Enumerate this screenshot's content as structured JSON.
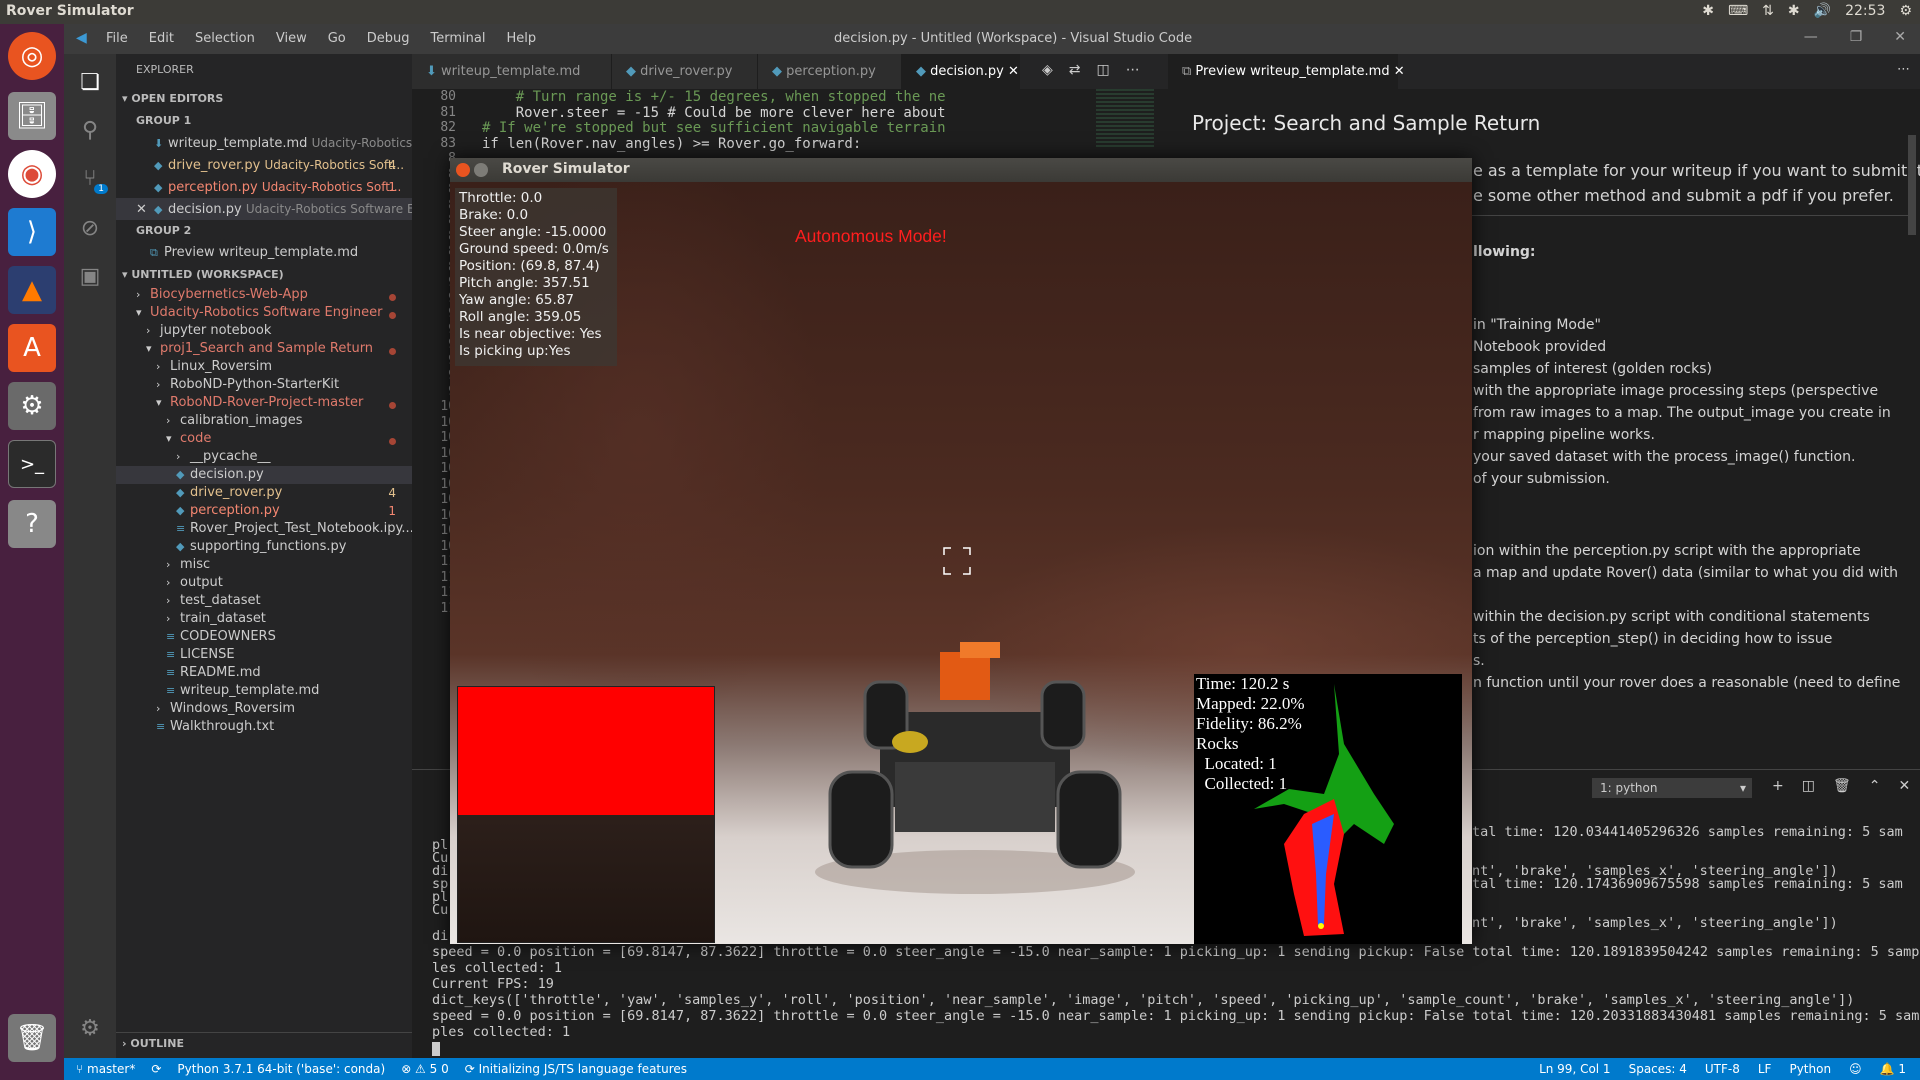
{
  "topbar": {
    "app_title": "Rover Simulator",
    "clock": "22:53"
  },
  "vscode": {
    "window_title": "decision.py - Untitled (Workspace) - Visual Studio Code",
    "menu": [
      "File",
      "Edit",
      "Selection",
      "View",
      "Go",
      "Debug",
      "Terminal",
      "Help"
    ],
    "scm_badge": "1"
  },
  "explorer": {
    "title": "EXPLORER",
    "open_editors": "OPEN EDITORS",
    "group1": "GROUP 1",
    "group2": "GROUP 2",
    "workspace": "UNTITLED (WORKSPACE)",
    "outline": "OUTLINE",
    "open_files": [
      {
        "name": "writeup_template.md",
        "path": "Udacity-Robotics ...",
        "badge": ""
      },
      {
        "name": "drive_rover.py",
        "path": "Udacity-Robotics Soft...",
        "badge": "4"
      },
      {
        "name": "perception.py",
        "path": "Udacity-Robotics Soft...",
        "badge": "1"
      },
      {
        "name": "decision.py",
        "path": "Udacity-Robotics Software E...",
        "badge": ""
      }
    ],
    "group2_file": "Preview writeup_template.md",
    "tree": [
      {
        "label": "Biocybernetics-Web-App",
        "indent": 0
      },
      {
        "label": "Udacity-Robotics Software Engineer",
        "indent": 0
      },
      {
        "label": "jupyter notebook",
        "indent": 1
      },
      {
        "label": "proj1_Search and Sample Return",
        "indent": 1
      },
      {
        "label": "Linux_Roversim",
        "indent": 2
      },
      {
        "label": "RoboND-Python-StarterKit",
        "indent": 2
      },
      {
        "label": "RoboND-Rover-Project-master",
        "indent": 2
      },
      {
        "label": "calibration_images",
        "indent": 3
      },
      {
        "label": "code",
        "indent": 3
      },
      {
        "label": "__pycache__",
        "indent": 4
      },
      {
        "label": "decision.py",
        "indent": 4
      },
      {
        "label": "drive_rover.py",
        "indent": 4,
        "badge": "4"
      },
      {
        "label": "perception.py",
        "indent": 4,
        "badge": "1"
      },
      {
        "label": "Rover_Project_Test_Notebook.ipy...",
        "indent": 4
      },
      {
        "label": "supporting_functions.py",
        "indent": 4
      },
      {
        "label": "misc",
        "indent": 3
      },
      {
        "label": "output",
        "indent": 3
      },
      {
        "label": "test_dataset",
        "indent": 3
      },
      {
        "label": "train_dataset",
        "indent": 3
      },
      {
        "label": "CODEOWNERS",
        "indent": 3
      },
      {
        "label": "LICENSE",
        "indent": 3
      },
      {
        "label": "README.md",
        "indent": 3
      },
      {
        "label": "writeup_template.md",
        "indent": 3
      },
      {
        "label": "Windows_Roversim",
        "indent": 2
      },
      {
        "label": "Walkthrough.txt",
        "indent": 2
      }
    ]
  },
  "tabs": [
    "writeup_template.md",
    "drive_rover.py",
    "perception.py",
    "decision.py"
  ],
  "preview_tab": "Preview writeup_template.md",
  "editor": {
    "lines": [
      {
        "n": "80",
        "code": "    # Turn range is +/- 15 degrees, when stopped the ne"
      },
      {
        "n": "81",
        "code": "    Rover.steer = -15 # Could be more clever here about"
      },
      {
        "n": "82",
        "code": "# If we're stopped but see sufficient navigable terrain"
      },
      {
        "n": "83",
        "code": "if len(Rover.nav_angles) >= Rover.go_forward:"
      }
    ],
    "gutter_more": [
      "8",
      "8",
      "8",
      "8",
      "8",
      "8",
      "8",
      "8",
      "9",
      "9",
      "9",
      "9",
      "9",
      "9",
      "9",
      "9",
      "10",
      "10",
      "10",
      "10",
      "10",
      "10",
      "10",
      "10",
      "10",
      "10",
      "11",
      "11",
      "11",
      "11"
    ]
  },
  "preview": {
    "heading": "Project: Search and Sample Return",
    "lines": [
      "e as a template for your writeup if you want to submit it",
      "e some other method and submit a pdf if you prefer.",
      "llowing:",
      "in \"Training Mode\"",
      "Notebook provided",
      "samples of interest (golden rocks)",
      "with the appropriate image processing steps (perspective",
      "from raw images to a map. The output_image you create in",
      "r mapping pipeline works.",
      "your saved dataset with the process_image() function.",
      "of your submission.",
      "ion within the perception.py script with the appropriate",
      "a map and update Rover() data (similar to what you did with",
      "within the decision.py script with conditional statements",
      "ts of the perception_step() in deciding how to issue",
      "s.",
      "n function until your rover does a reasonable (need to define"
    ]
  },
  "terminal": {
    "selector": "1: python",
    "right_lines": [
      "tal time: 120.03441405296326 samples remaining: 5 sam",
      "nt', 'brake', 'samples_x', 'steering_angle'])",
      "tal time: 120.17436909675598 samples remaining: 5 sam",
      "nt', 'brake', 'samples_x', 'steering_angle'])"
    ],
    "left_frag": [
      "pl",
      "Cu",
      "di",
      "sp",
      "pl",
      "Cu",
      "di"
    ],
    "lines": [
      "speed = 0.0 position = [69.8147, 87.3622] throttle = 0.0 steer_angle = -15.0 near_sample: 1 picking_up: 1 sending pickup: False total time: 120.1891839504242 samples remaining: 5 samp",
      "les collected: 1",
      "Current FPS: 19",
      "dict_keys(['throttle', 'yaw', 'samples_y', 'roll', 'position', 'near_sample', 'image', 'pitch', 'speed', 'picking_up', 'sample_count', 'brake', 'samples_x', 'steering_angle'])",
      "speed = 0.0 position = [69.8147, 87.3622] throttle = 0.0 steer_angle = -15.0 near_sample: 1 picking_up: 1 sending pickup: False total time: 120.20331883430481 samples remaining: 5 sam",
      "ples collected: 1"
    ]
  },
  "status": {
    "branch": "master*",
    "interpreter": "Python 3.7.1 64-bit ('base': conda)",
    "problems": "5  0",
    "task": "Initializing JS/TS language features",
    "cursor": "Ln 99, Col 1",
    "spaces": "Spaces: 4",
    "encoding": "UTF-8",
    "eol": "LF",
    "language": "Python",
    "notifications": "1"
  },
  "simulator": {
    "title": "Rover Simulator",
    "mode": "Autonomous Mode!",
    "hud": [
      "Throttle: 0.0",
      "Brake: 0.0",
      "Steer angle: -15.0000",
      "Ground speed: 0.0m/s",
      "Position: (69.8, 87.4)",
      "Pitch angle: 357.51",
      "Yaw angle: 65.87",
      "Roll angle: 359.05",
      "Is near objective: Yes",
      "Is picking up:Yes"
    ],
    "map_text": "Time: 120.2 s\nMapped: 22.0%\nFidelity: 86.2%\nRocks\n  Located: 1\n  Collected: 1"
  }
}
